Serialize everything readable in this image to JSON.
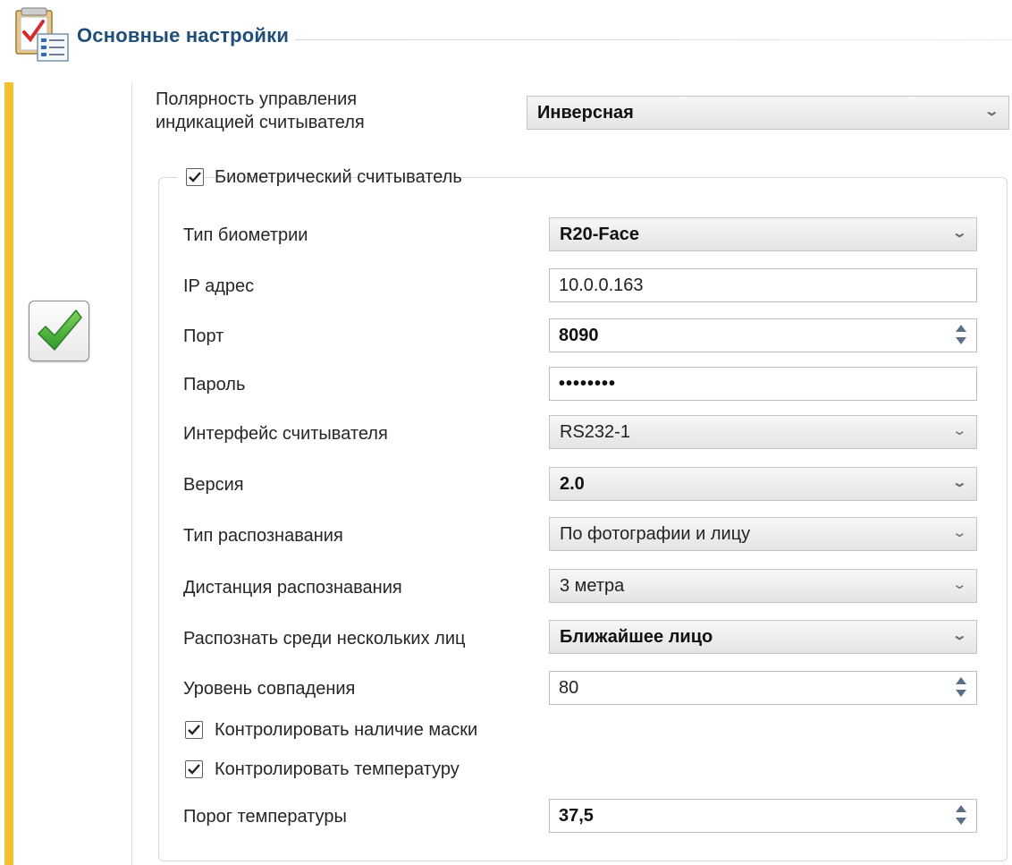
{
  "header": {
    "title": "Основные настройки",
    "icon": "settings-checklist-icon"
  },
  "polarity": {
    "label": "Полярность управления индикацией считывателя",
    "value": "Инверсная"
  },
  "biometric_group": {
    "enabled_label": "Биометрический считыватель",
    "enabled": true,
    "fields": {
      "biometry_type": {
        "label": "Тип биометрии",
        "value": "R20-Face"
      },
      "ip_address": {
        "label": "IP адрес",
        "value": "10.0.0.163"
      },
      "port": {
        "label": "Порт",
        "value": "8090"
      },
      "password": {
        "label": "Пароль",
        "value": "••••••••"
      },
      "reader_interface": {
        "label": "Интерфейс считывателя",
        "value": "RS232-1"
      },
      "version": {
        "label": "Версия",
        "value": "2.0"
      },
      "recognition_type": {
        "label": "Тип распознавания",
        "value": "По фотографии и лицу"
      },
      "recognition_distance": {
        "label": "Дистанция распознавания",
        "value": "3 метра"
      },
      "multi_face": {
        "label": "Распознать среди нескольких лиц",
        "value": "Ближайшее лицо"
      },
      "match_level": {
        "label": "Уровень совпадения",
        "value": "80"
      },
      "temperature_threshold": {
        "label": "Порог температуры",
        "value": "37,5"
      }
    },
    "check_mask": {
      "label": "Контролировать наличие маски",
      "checked": true
    },
    "check_temperature": {
      "label": "Контролировать температуру",
      "checked": true
    }
  },
  "status": {
    "icon": "green-checkmark-icon",
    "checked": true
  },
  "colors": {
    "accent": "#f5c02e",
    "title": "#1f4e79",
    "check_green": "#3da933"
  }
}
